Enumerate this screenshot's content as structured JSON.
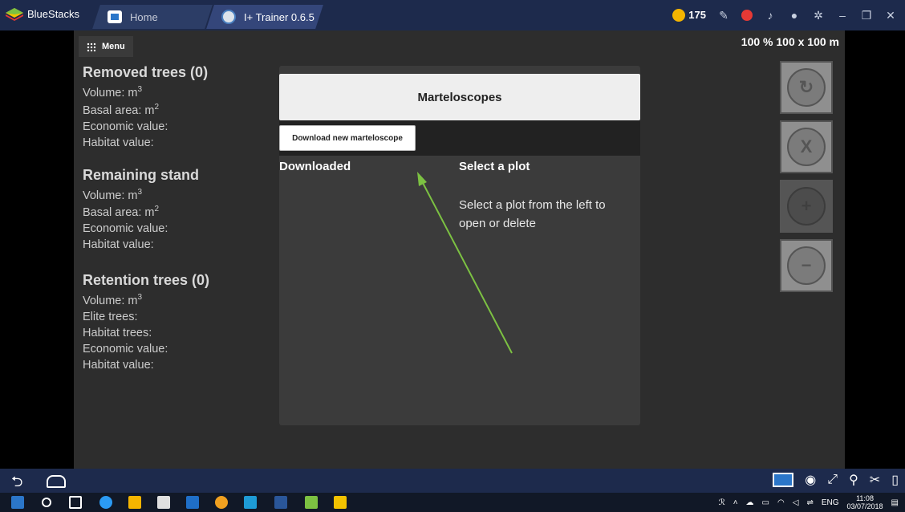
{
  "titlebar": {
    "app_name": "BlueStacks",
    "tabs": [
      {
        "label": "Home"
      },
      {
        "label": "I+ Trainer 0.6.5"
      }
    ],
    "coins": "175"
  },
  "app": {
    "menu_label": "Menu",
    "zoom_label": "100 % 100 x 100 m",
    "removed": {
      "heading": "Removed trees (0)",
      "volume": "Volume: m",
      "basal": "Basal area: m",
      "economic": "Economic value:",
      "habitat": "Habitat value:"
    },
    "remaining": {
      "heading": "Remaining stand",
      "volume": "Volume: m",
      "basal": "Basal area: m",
      "economic": "Economic value:",
      "habitat": "Habitat value:"
    },
    "retention": {
      "heading": "Retention trees (0)",
      "volume": "Volume: m",
      "elite": "Elite trees:",
      "habitat_trees": "Habitat trees:",
      "economic": "Economic value:",
      "habitat": "Habitat value:"
    },
    "sup3": "3",
    "sup2": "2"
  },
  "dialog": {
    "title": "Marteloscopes",
    "download_button": "Download new marteloscope",
    "downloaded_header": "Downloaded",
    "select_header": "Select a plot",
    "hint": "Select a plot from the left to open or delete"
  },
  "taskbar": {
    "lang": "ENG",
    "time": "11:08",
    "date": "03/07/2018"
  },
  "colors": {
    "annotation_arrow": "#7cc142",
    "chrome": "#1d2a4c"
  }
}
